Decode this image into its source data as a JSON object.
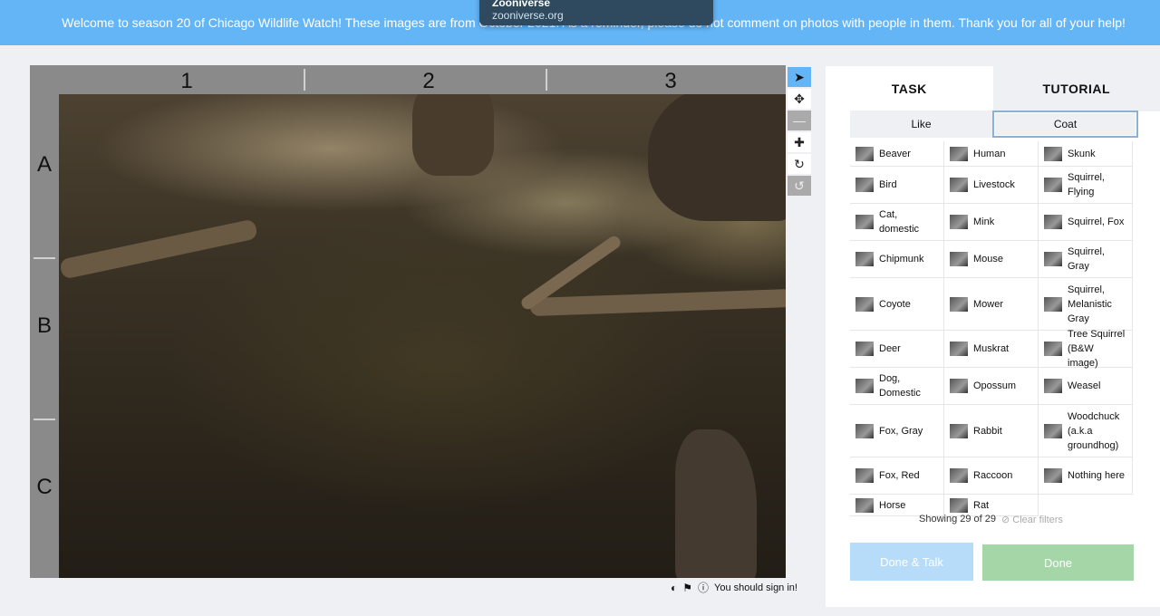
{
  "banner": {
    "text": "Welcome to season 20 of Chicago Wildlife Watch! These images are from October 2021. As a reminder, please do not comment on photos with people in them. Thank you for all of your help!"
  },
  "tooltip": {
    "title": "Zooniverse",
    "url": "zooniverse.org"
  },
  "viewer": {
    "columns": [
      "1",
      "2",
      "3"
    ],
    "rows": [
      "A",
      "B",
      "C"
    ],
    "tools": [
      "pointer-icon",
      "move-icon",
      "zoom-out-icon",
      "zoom-in-icon",
      "rotate-icon",
      "reset-icon"
    ]
  },
  "footer": {
    "signin": "You should sign in!"
  },
  "panel": {
    "tabs": {
      "task": "TASK",
      "tutorial": "TUTORIAL"
    },
    "filters": {
      "like": "Like",
      "coat": "Coat"
    },
    "choices": [
      "Beaver",
      "Human",
      "Skunk",
      "Bird",
      "Livestock",
      "Squirrel, Flying",
      "Cat, domestic",
      "Mink",
      "Squirrel, Fox",
      "Chipmunk",
      "Mouse",
      "Squirrel, Gray",
      "Coyote",
      "Mower",
      "Squirrel, Melanistic Gray",
      "Deer",
      "Muskrat",
      "Tree Squirrel (B&W image)",
      "Dog, Domestic",
      "Opossum",
      "Weasel",
      "Fox, Gray",
      "Rabbit",
      "Woodchuck (a.k.a groundhog)",
      "Fox, Red",
      "Raccoon",
      "Nothing here",
      "Horse",
      "Rat"
    ],
    "showing": "Showing 29 of 29",
    "clear_filters": "Clear filters",
    "done_talk": "Done & Talk",
    "done": "Done"
  }
}
